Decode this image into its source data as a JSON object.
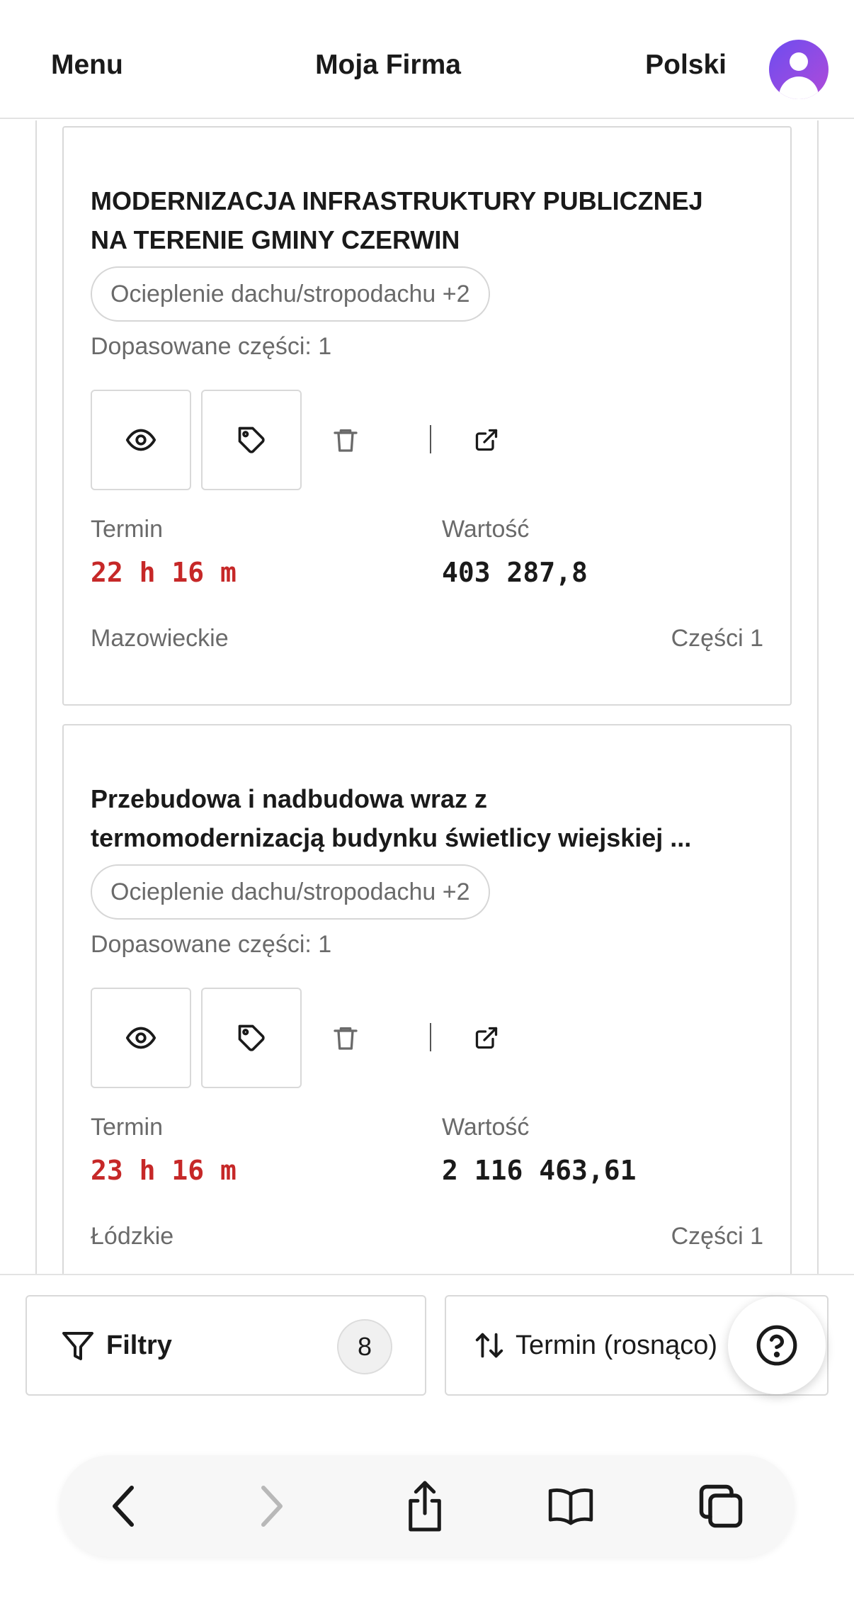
{
  "header": {
    "menu_label": "Menu",
    "brand": "Moja Firma",
    "language": "Polski"
  },
  "tenders": [
    {
      "title_line1": "MODERNIZACJA INFRASTRUKTURY PUBLICZNEJ",
      "title_line2": "NA TERENIE GMINY CZERWIN",
      "category_pill": "Ocieplenie dachu/stropodachu +2",
      "matched_parts": "Dopasowane części: 1",
      "deadline_label": "Termin",
      "deadline_value": "22 h 16 m",
      "value_label": "Wartość",
      "value": "403 287,8",
      "region": "Mazowieckie",
      "parts": "Części 1"
    },
    {
      "title_line1": "Przebudowa i nadbudowa wraz z",
      "title_line2": "termomodernizacją budynku świetlicy wiejskiej ...",
      "category_pill": "Ocieplenie dachu/stropodachu +2",
      "matched_parts": "Dopasowane części: 1",
      "deadline_label": "Termin",
      "deadline_value": "23 h 16 m",
      "value_label": "Wartość",
      "value": "2 116 463,61",
      "region": "Łódzkie",
      "parts": "Części 1"
    }
  ],
  "toolbar": {
    "filters_label": "Filtry",
    "filters_count": "8",
    "sort_label": "Termin (rosnąco)"
  },
  "icons": {
    "view": "eye-icon",
    "tag": "tag-icon",
    "delete": "trash-icon",
    "open": "external-link-icon",
    "filter": "filter-icon",
    "sort": "sort-icon",
    "help": "help-icon"
  },
  "colors": {
    "deadline": "#c62828",
    "avatar_gradient_start": "#6d4cf0",
    "avatar_gradient_end": "#b04bd9"
  }
}
